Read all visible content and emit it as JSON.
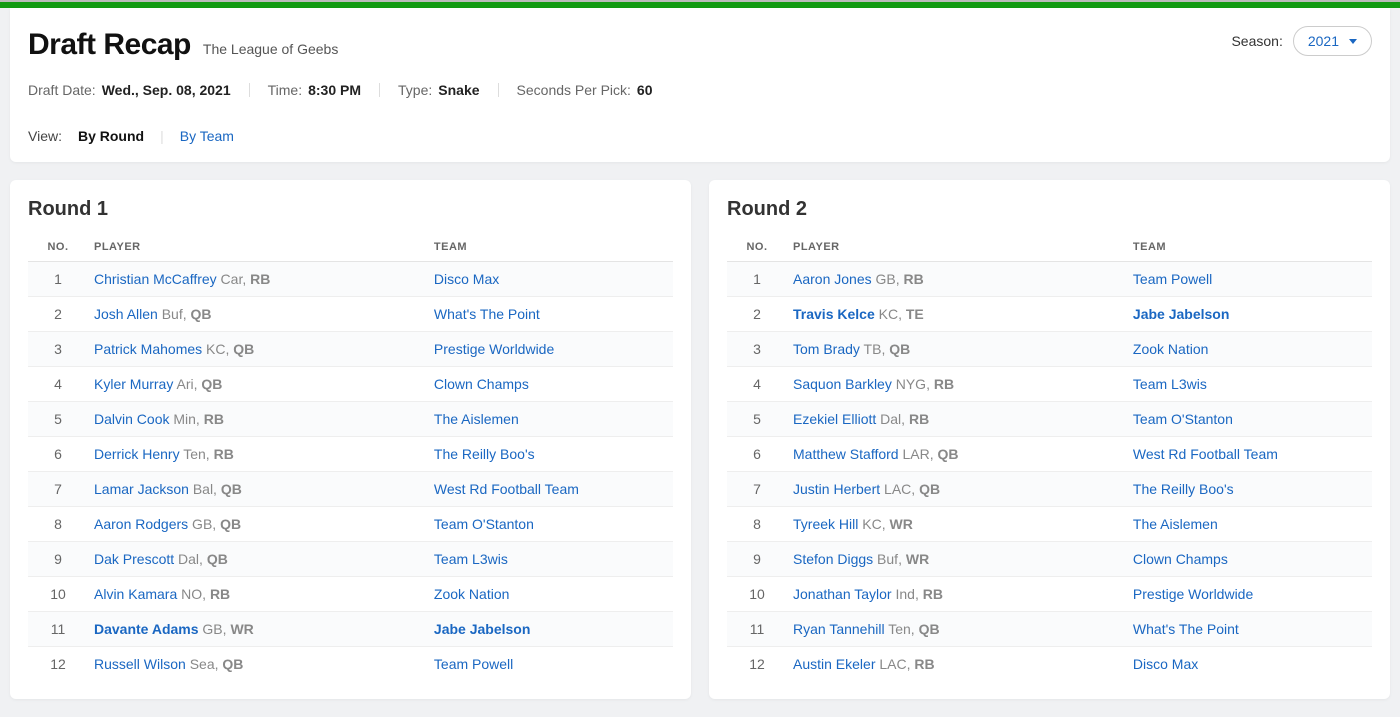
{
  "header": {
    "title": "Draft Recap",
    "league": "The League of Geebs",
    "season_label": "Season:",
    "season_value": "2021",
    "meta": {
      "date_label": "Draft Date:",
      "date_value": "Wed., Sep. 08, 2021",
      "time_label": "Time:",
      "time_value": "8:30 PM",
      "type_label": "Type:",
      "type_value": "Snake",
      "spp_label": "Seconds Per Pick:",
      "spp_value": "60"
    },
    "view": {
      "label": "View:",
      "by_round": "By Round",
      "by_team": "By Team"
    },
    "columns": {
      "no": "NO.",
      "player": "PLAYER",
      "team": "TEAM"
    }
  },
  "rounds": [
    {
      "title": "Round 1",
      "picks": [
        {
          "no": "1",
          "player": "Christian McCaffrey",
          "tm": "Car",
          "pos": "RB",
          "team": "Disco Max",
          "bold": false
        },
        {
          "no": "2",
          "player": "Josh Allen",
          "tm": "Buf",
          "pos": "QB",
          "team": "What's The Point",
          "bold": false
        },
        {
          "no": "3",
          "player": "Patrick Mahomes",
          "tm": "KC",
          "pos": "QB",
          "team": "Prestige Worldwide",
          "bold": false
        },
        {
          "no": "4",
          "player": "Kyler Murray",
          "tm": "Ari",
          "pos": "QB",
          "team": "Clown Champs",
          "bold": false
        },
        {
          "no": "5",
          "player": "Dalvin Cook",
          "tm": "Min",
          "pos": "RB",
          "team": "The Aislemen",
          "bold": false
        },
        {
          "no": "6",
          "player": "Derrick Henry",
          "tm": "Ten",
          "pos": "RB",
          "team": "The Reilly Boo's",
          "bold": false
        },
        {
          "no": "7",
          "player": "Lamar Jackson",
          "tm": "Bal",
          "pos": "QB",
          "team": "West Rd Football Team",
          "bold": false
        },
        {
          "no": "8",
          "player": "Aaron Rodgers",
          "tm": "GB",
          "pos": "QB",
          "team": "Team O'Stanton",
          "bold": false
        },
        {
          "no": "9",
          "player": "Dak Prescott",
          "tm": "Dal",
          "pos": "QB",
          "team": "Team L3wis",
          "bold": false
        },
        {
          "no": "10",
          "player": "Alvin Kamara",
          "tm": "NO",
          "pos": "RB",
          "team": "Zook Nation",
          "bold": false
        },
        {
          "no": "11",
          "player": "Davante Adams",
          "tm": "GB",
          "pos": "WR",
          "team": "Jabe Jabelson",
          "bold": true
        },
        {
          "no": "12",
          "player": "Russell Wilson",
          "tm": "Sea",
          "pos": "QB",
          "team": "Team Powell",
          "bold": false
        }
      ]
    },
    {
      "title": "Round 2",
      "picks": [
        {
          "no": "1",
          "player": "Aaron Jones",
          "tm": "GB",
          "pos": "RB",
          "team": "Team Powell",
          "bold": false
        },
        {
          "no": "2",
          "player": "Travis Kelce",
          "tm": "KC",
          "pos": "TE",
          "team": "Jabe Jabelson",
          "bold": true
        },
        {
          "no": "3",
          "player": "Tom Brady",
          "tm": "TB",
          "pos": "QB",
          "team": "Zook Nation",
          "bold": false
        },
        {
          "no": "4",
          "player": "Saquon Barkley",
          "tm": "NYG",
          "pos": "RB",
          "team": "Team L3wis",
          "bold": false
        },
        {
          "no": "5",
          "player": "Ezekiel Elliott",
          "tm": "Dal",
          "pos": "RB",
          "team": "Team O'Stanton",
          "bold": false
        },
        {
          "no": "6",
          "player": "Matthew Stafford",
          "tm": "LAR",
          "pos": "QB",
          "team": "West Rd Football Team",
          "bold": false
        },
        {
          "no": "7",
          "player": "Justin Herbert",
          "tm": "LAC",
          "pos": "QB",
          "team": "The Reilly Boo's",
          "bold": false
        },
        {
          "no": "8",
          "player": "Tyreek Hill",
          "tm": "KC",
          "pos": "WR",
          "team": "The Aislemen",
          "bold": false
        },
        {
          "no": "9",
          "player": "Stefon Diggs",
          "tm": "Buf",
          "pos": "WR",
          "team": "Clown Champs",
          "bold": false
        },
        {
          "no": "10",
          "player": "Jonathan Taylor",
          "tm": "Ind",
          "pos": "RB",
          "team": "Prestige Worldwide",
          "bold": false
        },
        {
          "no": "11",
          "player": "Ryan Tannehill",
          "tm": "Ten",
          "pos": "QB",
          "team": "What's The Point",
          "bold": false
        },
        {
          "no": "12",
          "player": "Austin Ekeler",
          "tm": "LAC",
          "pos": "RB",
          "team": "Disco Max",
          "bold": false
        }
      ]
    }
  ]
}
